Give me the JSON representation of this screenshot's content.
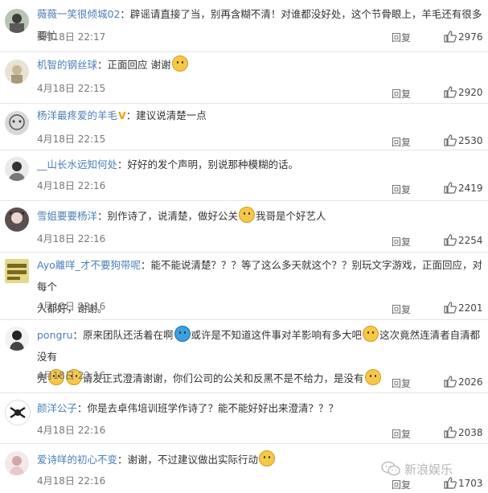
{
  "comments": [
    {
      "username": "薇薇一笑很倾城02",
      "verified": false,
      "text": "辟谣请直接了当，别再含糊不清！对谁都没好处，这个节骨眼上，羊毛还有很多要忙",
      "time": "4月18日 22:17",
      "reply": "回复",
      "likes": "2976"
    },
    {
      "username": "机智的钢丝球",
      "verified": false,
      "text": "正面回应 谢谢",
      "time": "4月18日 22:15",
      "reply": "回复",
      "likes": "2920"
    },
    {
      "username": "杨洋最疼爱的羊毛",
      "verified": true,
      "text": "建议说清楚一点",
      "time": "4月18日 22:15",
      "reply": "回复",
      "likes": "2530"
    },
    {
      "username": "__山长水远知何处",
      "verified": false,
      "text": "好好的发个声明，别说那种模糊的话。",
      "time": "4月18日 22:16",
      "reply": "回复",
      "likes": "2419"
    },
    {
      "username": "雪姐要要杨洋",
      "verified": false,
      "text_a": "别作诗了，说清楚，做好公关",
      "text_b": "我哥是个好艺人",
      "time": "4月18日 22:16",
      "reply": "回复",
      "likes": "2254"
    },
    {
      "username": "Ayo離咩_才不要狗带呢",
      "verified": false,
      "text_l1": "能不能说清楚？？？等了这么多天就这个？？别玩文字游戏，正面回应，对每个",
      "text_l2": "人都好，谢谢。",
      "time": "4月18日 22:16",
      "reply": "回复",
      "likes": "2201"
    },
    {
      "username": "pongru",
      "verified": false,
      "t1": "原来团队还活着在啊",
      "t2": "或许是不知道这件事对羊影响有多大吧",
      "t3": "这次竟然连清者自清都没有",
      "t4": "壳",
      "t5": "请发正式澄清谢谢，你们公司的公关和反黑不是不给力，是没有",
      "time": "4月18日 22:16",
      "reply": "回复",
      "likes": "2026"
    },
    {
      "username": "颜洋公子",
      "verified": false,
      "text": "你是去卓伟培训班学作诗了？能不能好好出来澄清？？？",
      "time": "4月18日 22:16",
      "reply": "回复",
      "likes": "2038"
    },
    {
      "username": "爱诗咩的初心不变",
      "verified": false,
      "text": "谢谢，不过建议做出实际行动",
      "time": "4月18日 22:16",
      "reply": "回复",
      "likes": "1703"
    }
  ],
  "watermark": "新浪娱乐",
  "colors": {
    "username": "#4b7fb8",
    "text": "#333333",
    "time": "#777777",
    "divider": "#e6e6e6",
    "emoji": "#f6c84a",
    "badge": "#f0a000"
  }
}
